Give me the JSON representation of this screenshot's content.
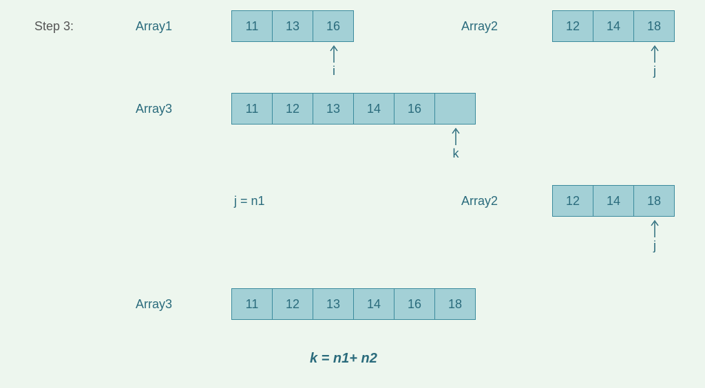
{
  "step_label": "Step 3:",
  "labels": {
    "array1": "Array1",
    "array2": "Array2",
    "array3": "Array3"
  },
  "row1": {
    "array1": {
      "cells": [
        "11",
        "13",
        "16"
      ],
      "pointer": {
        "label": "i",
        "index": 2
      }
    },
    "array2": {
      "cells": [
        "12",
        "14",
        "18"
      ],
      "pointer": {
        "label": "j",
        "index": 2
      }
    }
  },
  "row2": {
    "array3": {
      "cells": [
        "11",
        "12",
        "13",
        "14",
        "16",
        ""
      ],
      "pointer": {
        "label": "k",
        "index": 5
      }
    }
  },
  "row3": {
    "formula": "j = n1",
    "array2": {
      "cells": [
        "12",
        "14",
        "18"
      ],
      "pointer": {
        "label": "j",
        "index": 2
      }
    }
  },
  "row4": {
    "array3": {
      "cells": [
        "11",
        "12",
        "13",
        "14",
        "16",
        "18"
      ]
    }
  },
  "final_formula": "k = n1+ n2",
  "colors": {
    "cell_bg": "#a3d0d6",
    "cell_border": "#3a8a9c",
    "page_bg": "#edf6ee",
    "text": "#2a6b7c"
  }
}
